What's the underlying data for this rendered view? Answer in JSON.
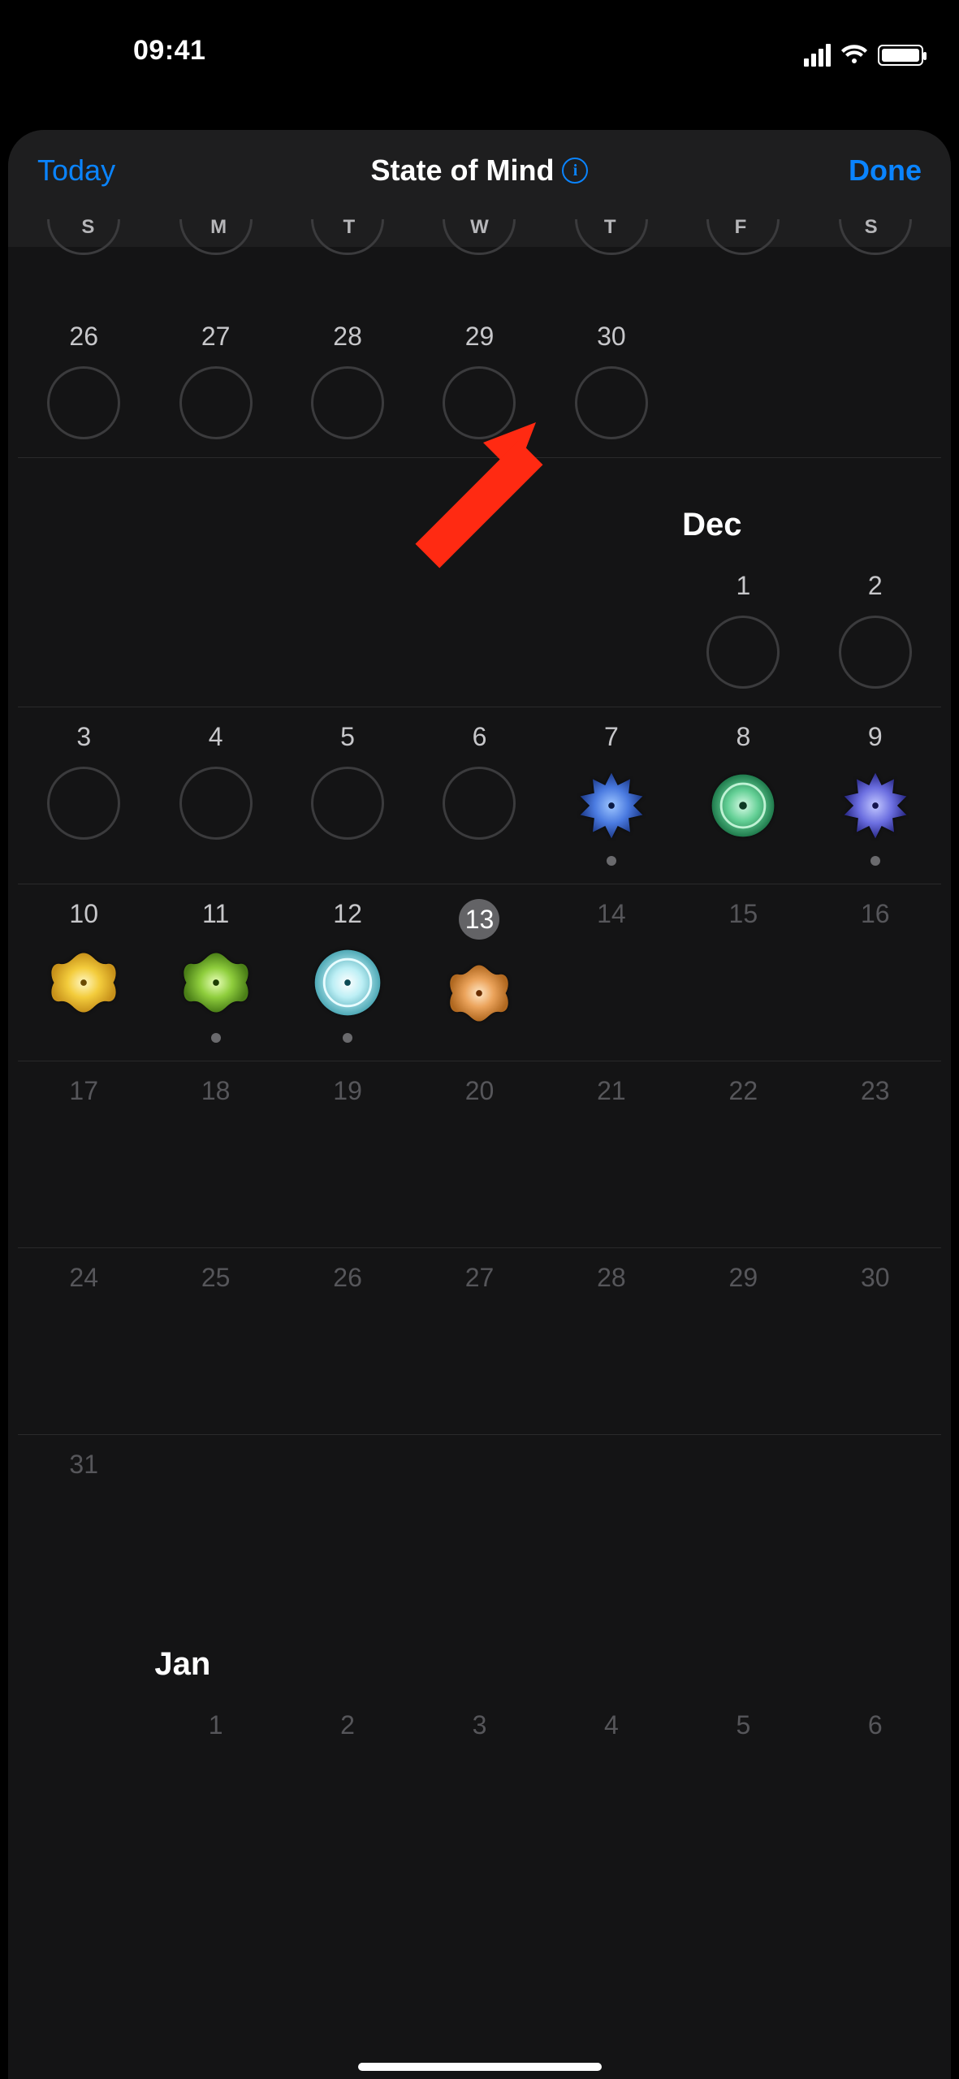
{
  "status": {
    "time": "09:41"
  },
  "nav": {
    "today": "Today",
    "title": "State of Mind",
    "done": "Done"
  },
  "dow": [
    "S",
    "M",
    "T",
    "W",
    "T",
    "F",
    "S"
  ],
  "months": {
    "dec": "Dec",
    "jan": "Jan"
  },
  "nov_last": {
    "days": [
      "26",
      "27",
      "28",
      "29",
      "30"
    ]
  },
  "dec": {
    "w1": {
      "days": [
        "1",
        "2"
      ]
    },
    "w2": {
      "days": [
        "3",
        "4",
        "5",
        "6",
        "7",
        "8",
        "9"
      ],
      "states": [
        null,
        null,
        null,
        null,
        {
          "kind": "very-unpleasant",
          "color": "blue",
          "dot": true
        },
        {
          "kind": "unpleasant",
          "color": "green",
          "dot": false
        },
        {
          "kind": "very-unpleasant",
          "color": "blue-purple",
          "dot": true
        }
      ]
    },
    "w3": {
      "days": [
        "10",
        "11",
        "12",
        "13",
        "14",
        "15",
        "16"
      ],
      "today_index": 3,
      "states": [
        {
          "kind": "very-pleasant",
          "color": "yellow",
          "dot": false
        },
        {
          "kind": "pleasant",
          "color": "lime",
          "dot": true
        },
        {
          "kind": "neutral",
          "color": "cyan",
          "dot": true
        },
        {
          "kind": "slightly-pleasant",
          "color": "orange",
          "dot": false
        },
        null,
        null,
        null
      ]
    },
    "w4": {
      "days": [
        "17",
        "18",
        "19",
        "20",
        "21",
        "22",
        "23"
      ]
    },
    "w5": {
      "days": [
        "24",
        "25",
        "26",
        "27",
        "28",
        "29",
        "30"
      ]
    },
    "w6": {
      "days": [
        "31"
      ]
    }
  },
  "jan": {
    "w1": {
      "days": [
        "1",
        "2",
        "3",
        "4",
        "5",
        "6"
      ]
    }
  },
  "colors": {
    "very-unpleasant": "#3f6fd8",
    "very-unpleasant2": "#586bd5",
    "unpleasant": "#57c88e",
    "neutral": "#9fdfe8",
    "slightly-pleasant": "#e9a15a",
    "pleasant": "#88c83f",
    "very-pleasant": "#f2c73a"
  }
}
